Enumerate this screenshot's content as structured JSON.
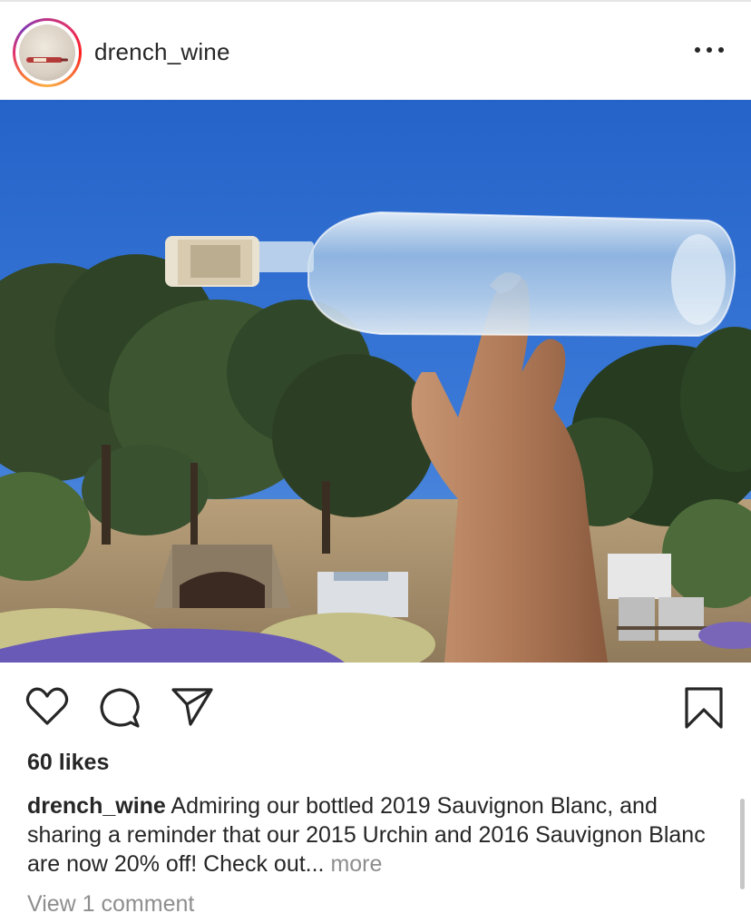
{
  "post": {
    "username": "drench_wine",
    "more_icon": "more-horizontal-icon",
    "likes_text": "60 likes",
    "caption_user": "drench_wine",
    "caption_text": " Admiring our bottled 2019 Sauvignon Blanc, and sharing a reminder that our 2015 Urchin and 2016 Sauvignon Blanc are now 20% off! Check out... ",
    "caption_more": "more",
    "view_comments": "View 1 comment",
    "actions": {
      "like_icon": "heart-icon",
      "comment_icon": "comment-icon",
      "share_icon": "paper-plane-icon",
      "save_icon": "bookmark-icon"
    }
  },
  "colors": {
    "text": "#262626",
    "muted": "#8e8e8e",
    "sky": "#2f6fd0",
    "lavender": "#6a5ab8"
  }
}
